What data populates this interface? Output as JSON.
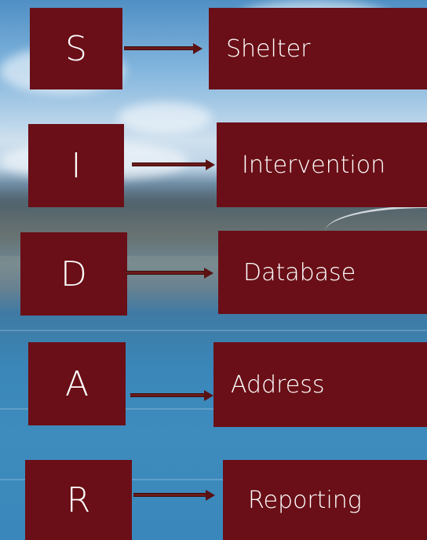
{
  "rows": [
    {
      "letter": "S",
      "word": "Shelter"
    },
    {
      "letter": "I",
      "word": "Intervention"
    },
    {
      "letter": "D",
      "word": "Database"
    },
    {
      "letter": "A",
      "word": "Address"
    },
    {
      "letter": "R",
      "word": "Reporting"
    }
  ],
  "colors": {
    "box": "#6a0f17",
    "arrow": "#6a1a1a",
    "text": "#ffffff"
  },
  "background": "city-river-photo"
}
